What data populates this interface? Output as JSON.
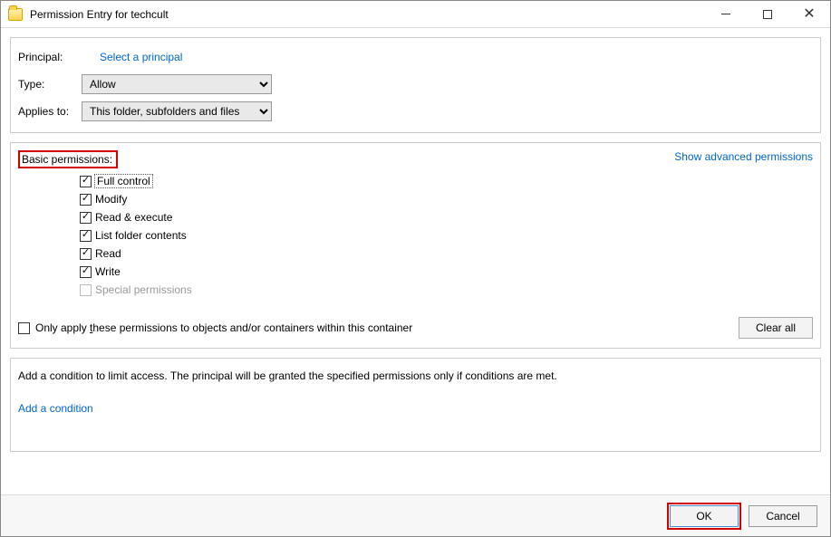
{
  "window": {
    "title": "Permission Entry for techcult"
  },
  "head": {
    "principal_label": "Principal:",
    "select_principal": "Select a principal",
    "type_label": "Type:",
    "type_value": "Allow",
    "applies_label": "Applies to:",
    "applies_value": "This folder, subfolders and files"
  },
  "perm": {
    "heading": "Basic permissions:",
    "show_advanced": "Show advanced permissions",
    "items": [
      {
        "label": "Full control",
        "checked": true,
        "focused": true
      },
      {
        "label": "Modify",
        "checked": true
      },
      {
        "label": "Read & execute",
        "checked": true
      },
      {
        "label": "List folder contents",
        "checked": true
      },
      {
        "label": "Read",
        "checked": true
      },
      {
        "label": "Write",
        "checked": true
      },
      {
        "label": "Special permissions",
        "checked": false,
        "disabled": true
      }
    ],
    "only_apply": "Only apply these permissions to objects and/or containers within this container",
    "clear_all": "Clear all"
  },
  "cond": {
    "text": "Add a condition to limit access. The principal will be granted the specified permissions only if conditions are met.",
    "add": "Add a condition"
  },
  "footer": {
    "ok": "OK",
    "cancel": "Cancel"
  }
}
